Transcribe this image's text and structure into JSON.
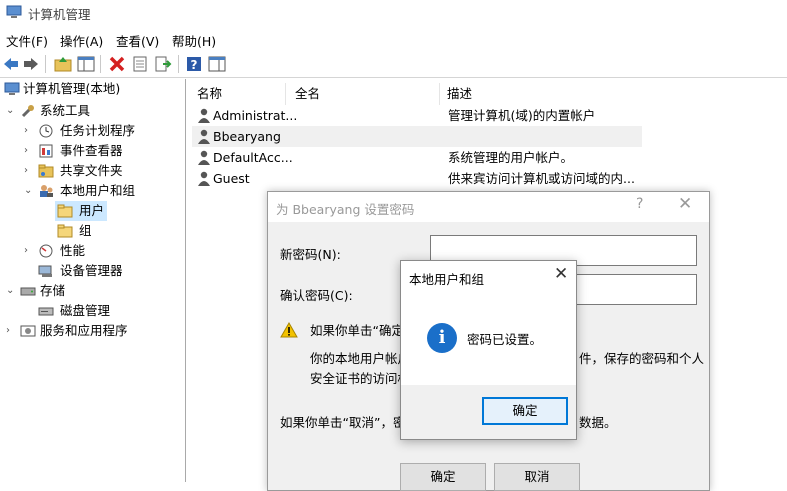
{
  "window": {
    "title": "计算机管理"
  },
  "menu": [
    "文件(F)",
    "操作(A)",
    "查看(V)",
    "帮助(H)"
  ],
  "toolbar": [
    "back-icon",
    "forward-icon",
    "up-folder-icon",
    "show-hide-tree-icon",
    "delete-icon",
    "properties-icon",
    "export-icon",
    "help-icon",
    "view-icon"
  ],
  "tree": {
    "root": "计算机管理(本地)",
    "system_tools": "系统工具",
    "task_scheduler": "任务计划程序",
    "event_viewer": "事件查看器",
    "shared_folders": "共享文件夹",
    "local_users_groups": "本地用户和组",
    "users": "用户",
    "groups": "组",
    "performance": "性能",
    "device_manager": "设备管理器",
    "storage": "存储",
    "disk_management": "磁盘管理",
    "services_apps": "服务和应用程序"
  },
  "list": {
    "columns": {
      "name": "名称",
      "fullname": "全名",
      "description": "描述"
    },
    "rows": [
      {
        "name": "Administrat...",
        "fullname": "",
        "description": "管理计算机(域)的内置帐户"
      },
      {
        "name": "Bbearyang",
        "fullname": "",
        "description": ""
      },
      {
        "name": "DefaultAcc...",
        "fullname": "",
        "description": "系统管理的用户帐户。"
      },
      {
        "name": "Guest",
        "fullname": "",
        "description": "供来宾访问计算机或访问域的内..."
      }
    ]
  },
  "pw_dialog": {
    "title": "为 Bbearyang 设置密码",
    "help": "?",
    "close": "✕",
    "new_password_label": "新密码(N):",
    "confirm_password_label": "确认密码(C):",
    "warn_line1": "如果你单击“确定",
    "warn_line2_left": "你的本地用户帐户",
    "warn_line2_right": "件，保存的密码和个人",
    "warn_line3": "安全证书的访问权",
    "cancel_line_left": "如果你单击“取消”，密",
    "cancel_line_right": "数据。",
    "ok": "确定",
    "cancel": "取消"
  },
  "msgbox": {
    "title": "本地用户和组",
    "close": "✕",
    "info_glyph": "i",
    "message": "密码已设置。",
    "ok": "确定"
  }
}
